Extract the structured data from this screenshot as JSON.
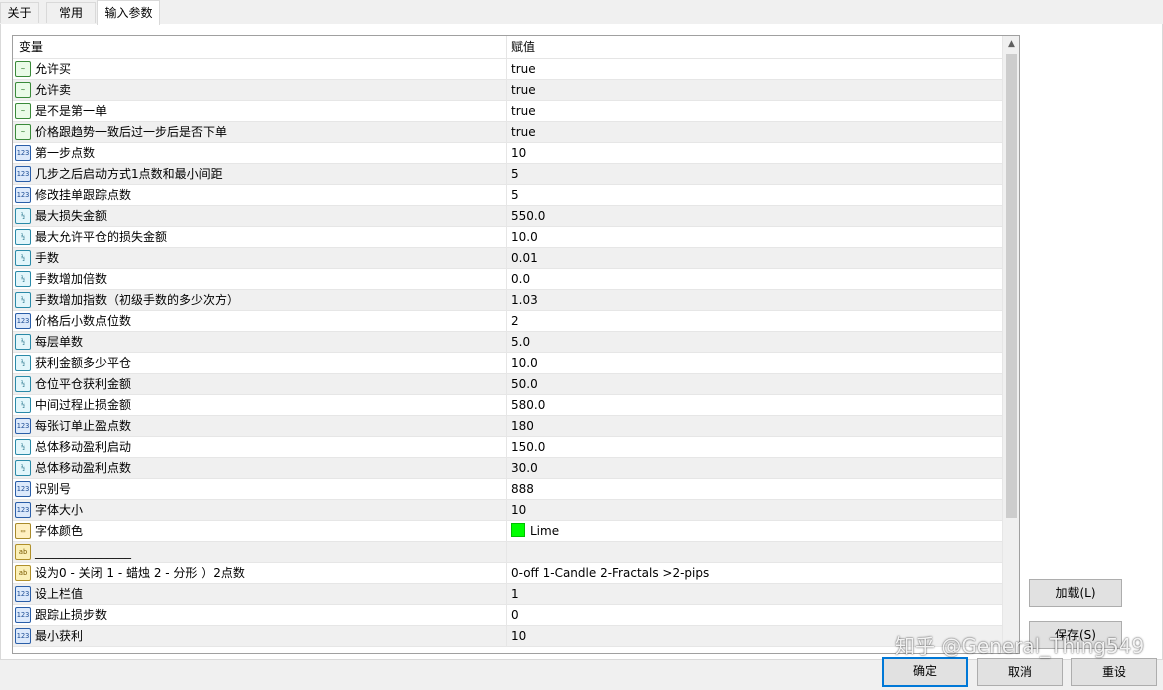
{
  "tabs": [
    "关于",
    "常用",
    "输入参数"
  ],
  "active_tab": "输入参数",
  "grid": {
    "col_variable": "变量",
    "col_value": "赋值",
    "rows": [
      {
        "type": "bool",
        "icon": "bool-icon",
        "name": "允许买",
        "value": "true"
      },
      {
        "type": "bool",
        "icon": "bool-icon",
        "name": "允许卖",
        "value": "true"
      },
      {
        "type": "bool",
        "icon": "bool-icon",
        "name": "是不是第一单",
        "value": "true"
      },
      {
        "type": "bool",
        "icon": "bool-icon",
        "name": "价格跟趋势一致后过一步后是否下单",
        "value": "true"
      },
      {
        "type": "int",
        "icon": "int-icon",
        "name": "第一步点数",
        "value": "10"
      },
      {
        "type": "int",
        "icon": "int-icon",
        "name": "几步之后启动方式1点数和最小间距",
        "value": "5"
      },
      {
        "type": "int",
        "icon": "int-icon",
        "name": "修改挂单跟踪点数",
        "value": "5"
      },
      {
        "type": "dbl",
        "icon": "double-icon",
        "name": "最大损失金额",
        "value": "550.0"
      },
      {
        "type": "dbl",
        "icon": "double-icon",
        "name": "最大允许平仓的损失金额",
        "value": "10.0"
      },
      {
        "type": "dbl",
        "icon": "double-icon",
        "name": "手数",
        "value": "0.01"
      },
      {
        "type": "dbl",
        "icon": "double-icon",
        "name": "手数增加倍数",
        "value": "0.0"
      },
      {
        "type": "dbl",
        "icon": "double-icon",
        "name": "手数增加指数（初级手数的多少次方）",
        "value": "1.03"
      },
      {
        "type": "int",
        "icon": "int-icon",
        "name": "价格后小数点位数",
        "value": "2"
      },
      {
        "type": "dbl",
        "icon": "double-icon",
        "name": "每层单数",
        "value": "5.0"
      },
      {
        "type": "dbl",
        "icon": "double-icon",
        "name": "获利金额多少平仓",
        "value": "10.0"
      },
      {
        "type": "dbl",
        "icon": "double-icon",
        "name": "仓位平仓获利金额",
        "value": "50.0"
      },
      {
        "type": "dbl",
        "icon": "double-icon",
        "name": "中间过程止损金额",
        "value": "580.0"
      },
      {
        "type": "int",
        "icon": "int-icon",
        "name": "每张订单止盈点数",
        "value": "180"
      },
      {
        "type": "dbl",
        "icon": "double-icon",
        "name": "总体移动盈利启动",
        "value": "150.0"
      },
      {
        "type": "dbl",
        "icon": "double-icon",
        "name": "总体移动盈利点数",
        "value": "30.0"
      },
      {
        "type": "int",
        "icon": "int-icon",
        "name": "识别号",
        "value": "888"
      },
      {
        "type": "int",
        "icon": "int-icon",
        "name": "字体大小",
        "value": "10"
      },
      {
        "type": "color",
        "icon": "color-icon",
        "name": "字体颜色",
        "value": "Lime",
        "color": "#00ff00"
      },
      {
        "type": "str",
        "icon": "string-icon",
        "name": "________________",
        "value": ""
      },
      {
        "type": "str",
        "icon": "string-icon",
        "name": "设为0 - 关闭 1 - 蜡烛 2 - 分形 ）2点数",
        "value": "0-off  1-Candle  2-Fractals  >2-pips"
      },
      {
        "type": "int",
        "icon": "int-icon",
        "name": "设上栏值",
        "value": "1"
      },
      {
        "type": "int",
        "icon": "int-icon",
        "name": "跟踪止损步数",
        "value": "0"
      },
      {
        "type": "int",
        "icon": "int-icon",
        "name": "最小获利",
        "value": "10"
      }
    ]
  },
  "buttons": {
    "load": "加载(L)",
    "save": "保存(S)",
    "ok": "确定",
    "cancel": "取消",
    "reset": "重设"
  },
  "watermark": "知乎 @General_Thing549"
}
